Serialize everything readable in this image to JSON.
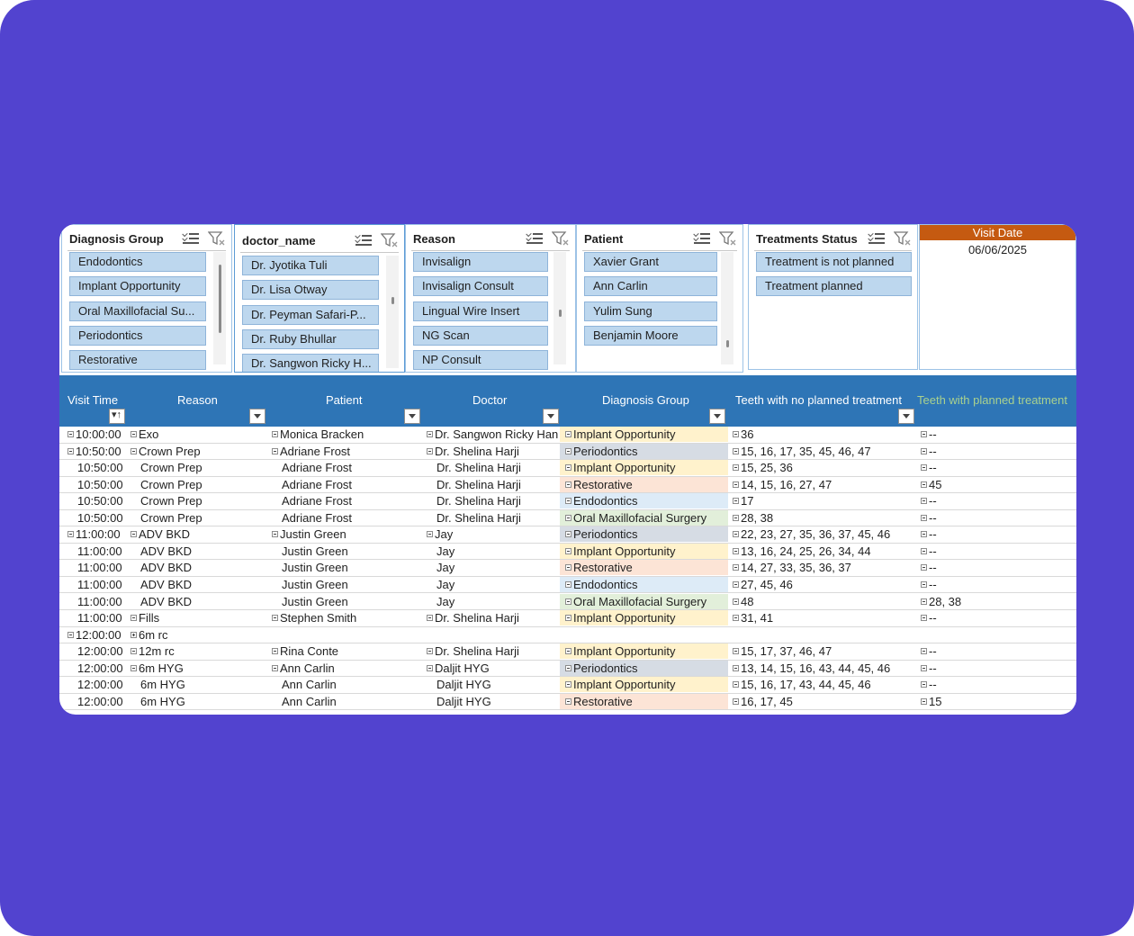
{
  "slicers": {
    "diagnosis": {
      "title": "Diagnosis Group",
      "items": [
        "Endodontics",
        "Implant Opportunity",
        "Oral Maxillofacial Su...",
        "Periodontics",
        "Restorative"
      ]
    },
    "doctor": {
      "title": "doctor_name",
      "items": [
        "Dr. Jyotika Tuli",
        "Dr. Lisa Otway",
        "Dr. Peyman Safari-P...",
        "Dr. Ruby Bhullar",
        "Dr. Sangwon Ricky H..."
      ]
    },
    "reason": {
      "title": "Reason",
      "items": [
        "Invisalign",
        "Invisalign Consult",
        "Lingual Wire Insert",
        "NG Scan",
        "NP Consult"
      ]
    },
    "patient": {
      "title": "Patient",
      "items": [
        "Xavier Grant",
        "Ann Carlin",
        "Yulim Sung",
        "Benjamin Moore"
      ]
    },
    "status": {
      "title": "Treatments Status",
      "items": [
        "Treatment is not planned",
        "Treatment planned"
      ]
    }
  },
  "visit_date": {
    "label": "Visit Date",
    "value": "06/06/2025"
  },
  "columns": [
    "Visit Time",
    "Reason",
    "Patient",
    "Doctor",
    "Diagnosis Group",
    "Teeth with no planned treatment",
    "Teeth with planned treatment"
  ],
  "colors": {
    "Implant Opportunity": "#fff2cc",
    "Periodontics": "#d6dce4",
    "Restorative": "#fce4d6",
    "Endodontics": "#ddebf7",
    "Oral Maxillofacial Surgery": "#e2efda"
  },
  "rows": [
    {
      "time": "10:00:00",
      "time_pm": "-",
      "reason": "Exo",
      "reason_pm": "-",
      "patient": "Monica Bracken",
      "patient_pm": "-",
      "doctor": "Dr. Sangwon Ricky Han",
      "doctor_pm": "-",
      "dg": "Implant Opportunity",
      "no": "36",
      "planned": "--"
    },
    {
      "time": "10:50:00",
      "time_pm": "-",
      "reason": "Crown Prep",
      "reason_pm": "-",
      "patient": "Adriane Frost",
      "patient_pm": "-",
      "doctor": "Dr. Shelina Harji",
      "doctor_pm": "-",
      "dg": "Periodontics",
      "no": "15, 16, 17, 35, 45, 46, 47",
      "planned": "--"
    },
    {
      "time": "10:50:00",
      "reason": "Crown Prep",
      "patient": "Adriane Frost",
      "doctor": "Dr. Shelina Harji",
      "dg": "Implant Opportunity",
      "no": "15, 25, 36",
      "planned": "--"
    },
    {
      "time": "10:50:00",
      "reason": "Crown Prep",
      "patient": "Adriane Frost",
      "doctor": "Dr. Shelina Harji",
      "dg": "Restorative",
      "no": "14, 15, 16, 27, 47",
      "planned": "45"
    },
    {
      "time": "10:50:00",
      "reason": "Crown Prep",
      "patient": "Adriane Frost",
      "doctor": "Dr. Shelina Harji",
      "dg": "Endodontics",
      "no": "17",
      "planned": "--"
    },
    {
      "time": "10:50:00",
      "reason": "Crown Prep",
      "patient": "Adriane Frost",
      "doctor": "Dr. Shelina Harji",
      "dg": "Oral Maxillofacial Surgery",
      "no": "28, 38",
      "planned": "--"
    },
    {
      "time": "11:00:00",
      "time_pm": "-",
      "reason": "ADV BKD",
      "reason_pm": "-",
      "patient": "Justin Green",
      "patient_pm": "-",
      "doctor": "Jay",
      "doctor_pm": "-",
      "dg": "Periodontics",
      "no": "22, 23, 27, 35, 36, 37, 45, 46",
      "planned": "--"
    },
    {
      "time": "11:00:00",
      "reason": "ADV BKD",
      "patient": "Justin Green",
      "doctor": "Jay",
      "dg": "Implant Opportunity",
      "no": "13, 16, 24, 25, 26, 34, 44",
      "planned": "--"
    },
    {
      "time": "11:00:00",
      "reason": "ADV BKD",
      "patient": "Justin Green",
      "doctor": "Jay",
      "dg": "Restorative",
      "no": "14, 27, 33, 35, 36, 37",
      "planned": "--"
    },
    {
      "time": "11:00:00",
      "reason": "ADV BKD",
      "patient": "Justin Green",
      "doctor": "Jay",
      "dg": "Endodontics",
      "no": "27, 45, 46",
      "planned": "--"
    },
    {
      "time": "11:00:00",
      "reason": "ADV BKD",
      "patient": "Justin Green",
      "doctor": "Jay",
      "dg": "Oral Maxillofacial Surgery",
      "no": "48",
      "planned": "28, 38"
    },
    {
      "time": "11:00:00",
      "reason": "Fills",
      "reason_pm": "-",
      "patient": "Stephen Smith",
      "patient_pm": "-",
      "doctor": "Dr. Shelina Harji",
      "doctor_pm": "-",
      "dg": "Implant Opportunity",
      "no": "31, 41",
      "planned": "--"
    },
    {
      "time": "12:00:00",
      "time_pm": "-",
      "reason": "6m rc",
      "reason_pm": "+",
      "patient": "",
      "doctor": "",
      "dg": "",
      "no": "",
      "planned": ""
    },
    {
      "time": "12:00:00",
      "reason": "12m rc",
      "reason_pm": "-",
      "patient": "Rina Conte",
      "patient_pm": "-",
      "doctor": "Dr. Shelina Harji",
      "doctor_pm": "-",
      "dg": "Implant Opportunity",
      "no": "15, 17, 37, 46, 47",
      "planned": "--"
    },
    {
      "time": "12:00:00",
      "reason": "6m HYG",
      "reason_pm": "-",
      "patient": "Ann Carlin",
      "patient_pm": "-",
      "doctor": "Daljit HYG",
      "doctor_pm": "-",
      "dg": "Periodontics",
      "no": "13, 14, 15, 16, 43, 44, 45, 46",
      "planned": "--"
    },
    {
      "time": "12:00:00",
      "reason": "6m HYG",
      "patient": "Ann Carlin",
      "doctor": "Daljit HYG",
      "dg": "Implant Opportunity",
      "no": "15, 16, 17, 43, 44, 45, 46",
      "planned": "--"
    },
    {
      "time": "12:00:00",
      "reason": "6m HYG",
      "patient": "Ann Carlin",
      "doctor": "Daljit HYG",
      "dg": "Restorative",
      "no": "16, 17, 45",
      "planned": "15"
    }
  ]
}
